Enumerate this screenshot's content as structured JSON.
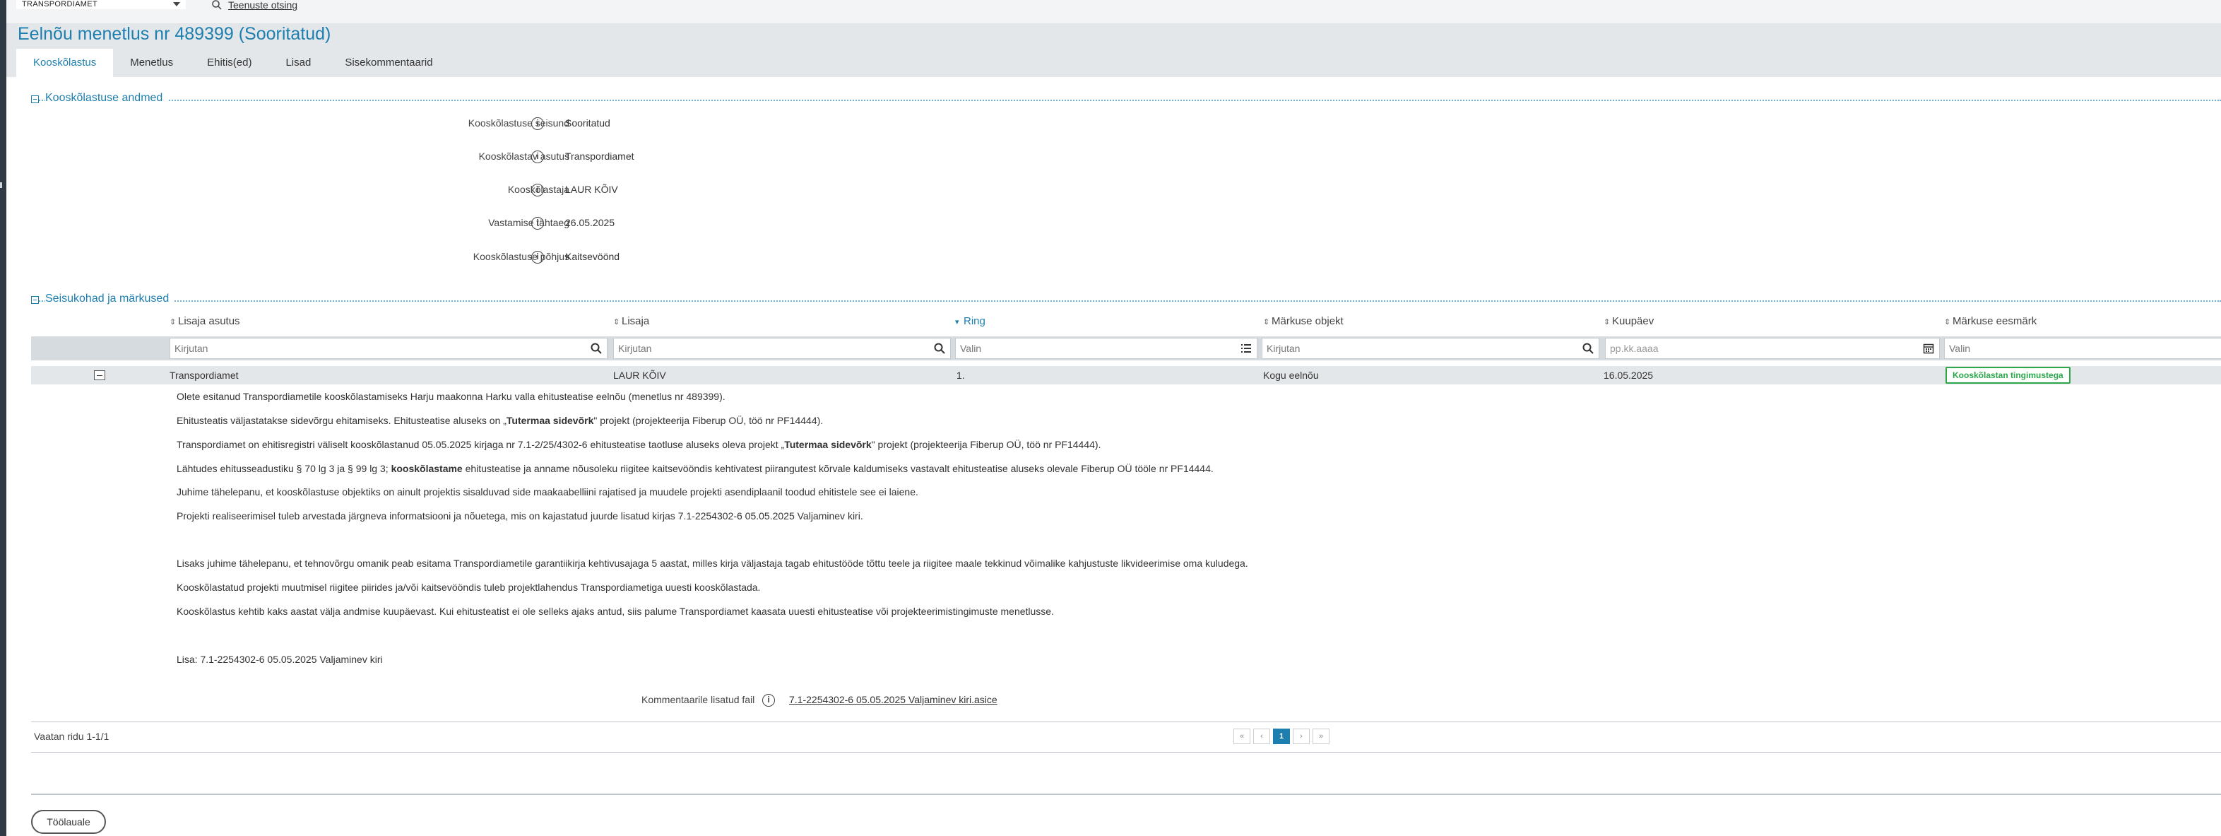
{
  "topbar": {
    "org_select": "TRANSPORDIAMET",
    "service_search": "Teenuste otsing"
  },
  "header": {
    "title": "Eelnõu menetlus nr 489399 (Sooritatud)",
    "tabs": [
      {
        "label": "Kooskõlastus",
        "active": true
      },
      {
        "label": "Menetlus"
      },
      {
        "label": "Ehitis(ed)"
      },
      {
        "label": "Lisad"
      },
      {
        "label": "Sisekommentaarid"
      }
    ]
  },
  "details": {
    "section_title": "Kooskõlastuse andmed",
    "rows": [
      {
        "label": "Kooskõlastuse seisund",
        "value": "Sooritatud"
      },
      {
        "label": "Kooskõlastav asutus",
        "value": "Transpordiamet"
      },
      {
        "label": "Kooskõlastaja",
        "value": "LAUR KÕIV"
      },
      {
        "label": "Vastamise tähtaeg",
        "value": "26.05.2025"
      },
      {
        "label": "Kooskõlastuse põhjus",
        "value": "Kaitsevöönd"
      }
    ]
  },
  "remarks": {
    "section_title": "Seisukohad ja märkused",
    "columns": [
      "Lisaja asutus",
      "Lisaja",
      "Ring",
      "Märkuse objekt",
      "Kuupäev",
      "Märkuse eesmärk"
    ],
    "filters": {
      "lisaja_asutus": "Kirjutan",
      "lisaja": "Kirjutan",
      "ring": "Valin",
      "objekt": "Kirjutan",
      "kuupaev": "pp.kk.aaaa",
      "eesmark": "Valin"
    },
    "row": {
      "asutus": "Transpordiamet",
      "lisaja": "LAUR KÕIV",
      "ring": "1.",
      "objekt": "Kogu eelnõu",
      "kuupaev": "16.05.2025",
      "eesmark": "Kooskõlastan tingimustega"
    },
    "comment": {
      "l1": "Olete esitanud Transpordiametile kooskõlastamiseks Harju maakonna Harku valla ehitusteatise eelnõu (menetlus nr 489399).",
      "l2a": "Ehitusteatis väljastatakse sidevõrgu ehitamiseks. Ehitusteatise aluseks on „",
      "l2b": "Tutermaa sidevõrk",
      "l2c": "\" projekt (projekteerija Fiberup OÜ, töö nr PF14444).",
      "l3a": "Transpordiamet on ehitisregistri väliselt kooskõlastanud 05.05.2025 kirjaga nr 7.1-2/25/4302-6 ehitusteatise taotluse aluseks oleva projekt „",
      "l3b": "Tutermaa sidevõrk",
      "l3c": "\" projekt (projekteerija Fiberup OÜ, töö nr PF14444).",
      "l4a": "Lähtudes ehitusseadustiku § 70 lg 3 ja § 99 lg 3; ",
      "l4b": "kooskõlastame",
      "l4c": " ehitusteatise ja anname nõusoleku riigitee kaitsevööndis kehtivatest piirangutest kõrvale kaldumiseks vastavalt ehitusteatise aluseks olevale Fiberup OÜ tööle nr PF14444.",
      "l5": "Juhime tähelepanu, et kooskõlastuse objektiks on ainult projektis sisalduvad side maakaabelliini rajatised ja muudele projekti asendiplaanil toodud ehitistele see ei laiene.",
      "l6": "Projekti realiseerimisel tuleb arvestada järgneva informatsiooni ja nõuetega, mis on kajastatud juurde lisatud kirjas 7.1-2254302-6 05.05.2025 Valjaminev kiri.",
      "l7": "Lisaks juhime tähelepanu, et tehnovõrgu omanik peab esitama Transpordiametile garantiikirja kehtivusajaga 5 aastat, milles kirja väljastaja tagab ehitustööde tõttu teele ja riigitee maale tekkinud võimalike kahjustuste likvideerimise oma kuludega.",
      "l8": "Kooskõlastatud projekti muutmisel riigitee piirides ja/või kaitsevööndis tuleb projektlahendus Transpordiametiga uuesti kooskõlastada.",
      "l9": "Kooskõlastus kehtib kaks aastat välja andmise kuupäevast. Kui ehitusteatist ei ole selleks ajaks antud, siis palume Transpordiamet kaasata uuesti ehitusteatise või projekteerimistingimuste menetlusse.",
      "l10": "Lisa: 7.1-2254302-6 05.05.2025 Valjaminev kiri"
    },
    "attachment_label": "Kommentaarile lisatud fail",
    "attachment_link": "7.1-2254302-6 05.05.2025 Valjaminev kiri.asice",
    "rows_info": "Vaatan ridu 1-1/1",
    "pager": {
      "first": "«",
      "prev": "‹",
      "current": "1",
      "next": "›",
      "last": "»"
    }
  },
  "footer": {
    "desk_button": "Töölauale"
  },
  "colors": {
    "accent": "#1d7fb0",
    "success": "#2aa84a"
  }
}
